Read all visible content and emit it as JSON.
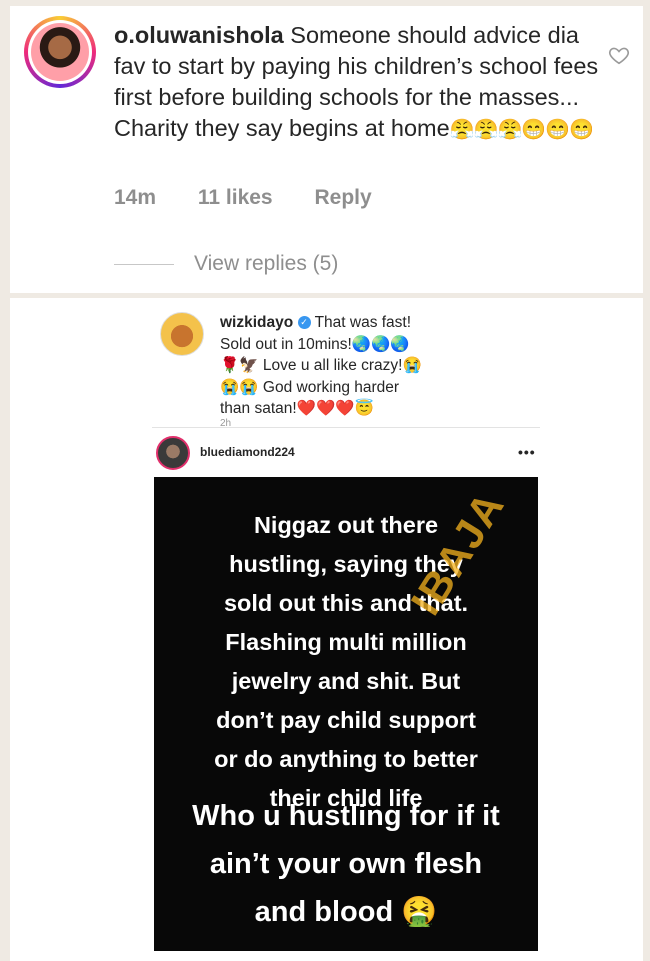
{
  "comment": {
    "username": "o.oluwanishola",
    "text": "Someone should advice dia fav to start by paying his children’s school fees first before building schools for the masses... Charity they say begins at home",
    "emojis": "😤😤😤😁😁😁",
    "time": "14m",
    "likes": "11 likes",
    "reply_label": "Reply",
    "view_replies": "View replies (5)"
  },
  "post": {
    "username": "wizkidayo",
    "line1": "That was fast!",
    "line2": "Sold out in 10mins!",
    "line2_emojis": "🌏🌏🌏",
    "line3_emojis": "🌹🦅",
    "line3": "Love u all like crazy!😭",
    "line4_emojis": "😭😭",
    "line4": "God working harder",
    "line5": "than satan!",
    "line5_emojis": "❤️❤️❤️😇",
    "time": "2h"
  },
  "story": {
    "username": "bluediamond224",
    "more": "•••",
    "lines": [
      "Niggaz out there",
      "hustling, saying they",
      "sold out this and that.",
      "Flashing multi million",
      "jewelry and shit. But",
      "don’t pay child support",
      "or do anything to better",
      "their child life"
    ],
    "big_lines": [
      "Who u hustling for if it",
      "ain’t your own flesh",
      "and blood 🤮"
    ],
    "watermark": "IBAJA"
  },
  "colors": {
    "background": "#efeae3",
    "text": "#262626",
    "muted": "#8e8e8e",
    "verified": "#3897f0",
    "watermark": "#f5b21e"
  },
  "icons": {
    "like": "heart-icon",
    "verified": "verified-icon",
    "more": "more-icon"
  }
}
